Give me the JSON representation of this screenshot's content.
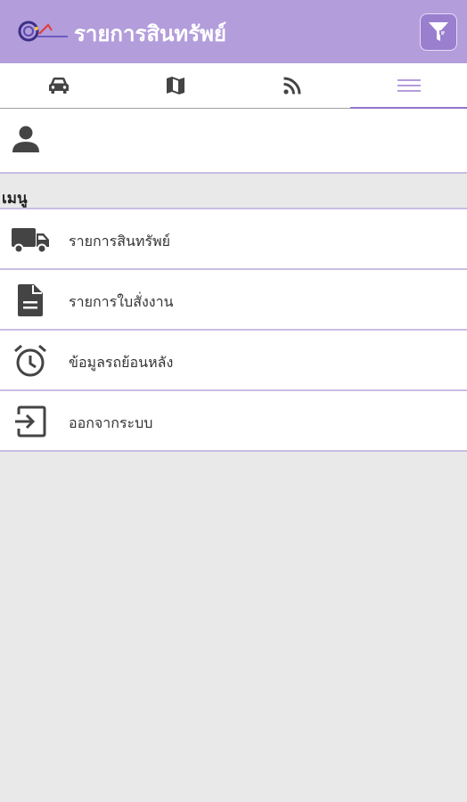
{
  "header": {
    "title": "รายการสินทรัพย์",
    "logo_icon": "company-logo-icon",
    "filter_icon": "filter-icon",
    "bg_color": "#b39ddb"
  },
  "tabs": [
    {
      "icon": "car-icon",
      "active": false
    },
    {
      "icon": "map-icon",
      "active": false
    },
    {
      "icon": "rss-feed-icon",
      "active": false
    },
    {
      "icon": "menu-icon",
      "active": true
    }
  ],
  "profile": {
    "icon": "person-icon"
  },
  "menu": {
    "section_label": "เมนู",
    "items": [
      {
        "label": "รายการสินทรัพย์",
        "icon": "truck-icon"
      },
      {
        "label": "รายการใบสั่งงาน",
        "icon": "document-icon"
      },
      {
        "label": "ข้อมูลรถย้อนหลัง",
        "icon": "alarm-clock-icon"
      },
      {
        "label": "ออกจากระบบ",
        "icon": "logout-icon"
      }
    ]
  },
  "colors": {
    "accent": "#9575cd",
    "divider": "#c8bde3",
    "icon": "#444444"
  }
}
